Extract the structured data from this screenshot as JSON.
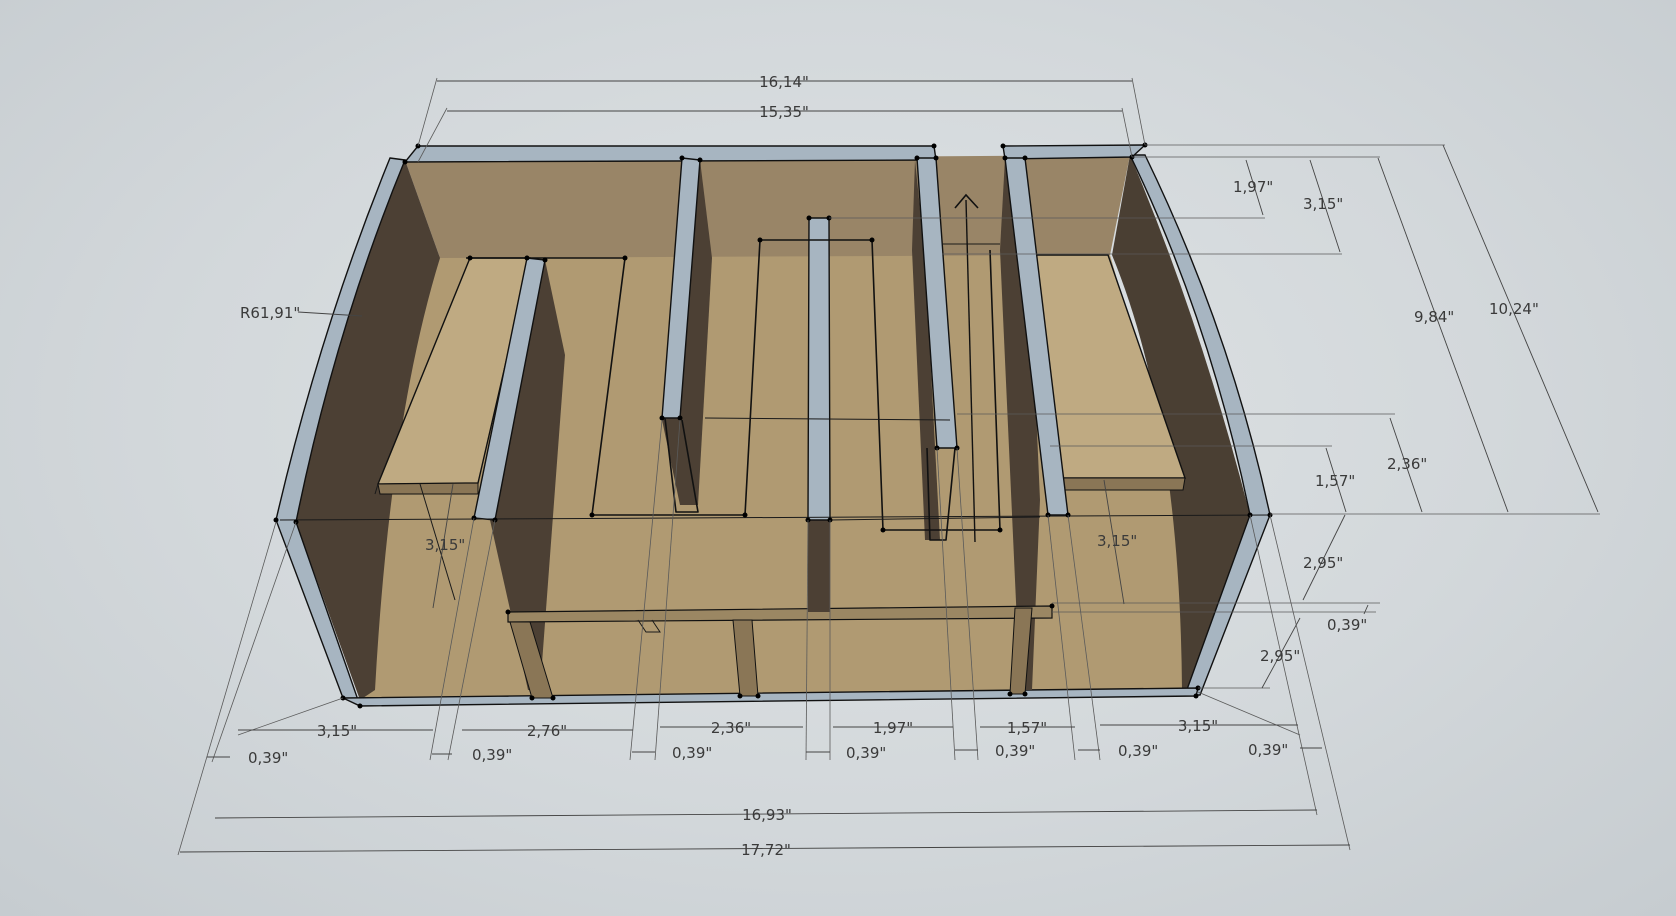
{
  "colors": {
    "background": "#d6dadd",
    "wall_top": "#a9b7c3",
    "wall_dark": "#4a3f33",
    "wall_mid": "#675846",
    "back_wall": "#9a8766",
    "floor": "#b09a72",
    "floor_light": "#b8a47c",
    "dimension_line": "#444444",
    "dimension_text": "#3a3a3a"
  },
  "icons": [
    "axis-arrow-icon"
  ],
  "labels": {
    "radius": "R61,91\"",
    "top_outer": "16,14\"",
    "top_inner": "15,35\"",
    "right_1": "1,97\"",
    "right_2": "3,15\"",
    "right_depth_inner": "9,84\"",
    "right_depth_outer": "10,24\"",
    "right_3": "2,36\"",
    "right_4": "1,57\"",
    "right_5": "2,95\"",
    "right_6": "0,39\"",
    "right_7": "2,95\"",
    "inner_left": "3,15\"",
    "inner_right": "3,15\"",
    "bottom_segments": [
      "3,15\"",
      "2,76\"",
      "2,36\"",
      "1,97\"",
      "1,57\"",
      "3,15\""
    ],
    "bottom_walls": [
      "0,39\"",
      "0,39\"",
      "0,39\"",
      "0,39\"",
      "0,39\"",
      "0,39\"",
      "0,39\""
    ],
    "bottom_inner": "16,93\"",
    "bottom_outer": "17,72\""
  }
}
